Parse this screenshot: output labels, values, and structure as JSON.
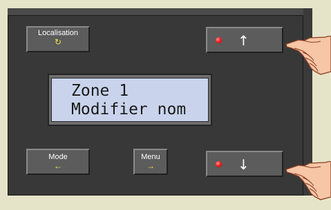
{
  "buttons": {
    "localisation": {
      "label": "Localisation",
      "icon": "↻"
    },
    "mode": {
      "label": "Mode",
      "icon": "←"
    },
    "menu": {
      "label": "Menu",
      "icon": "→"
    },
    "up": {
      "icon": "↑"
    },
    "down": {
      "icon": "↓"
    }
  },
  "display": {
    "line1": "Zone 1",
    "line2": "Modifier nom"
  },
  "colors": {
    "background": "#e6e4c8",
    "device": "#383838",
    "button": "#5c5c5c",
    "lcd": "#c9d4ec",
    "led": "#ff2020",
    "icon_accent": "#f1e44a"
  }
}
